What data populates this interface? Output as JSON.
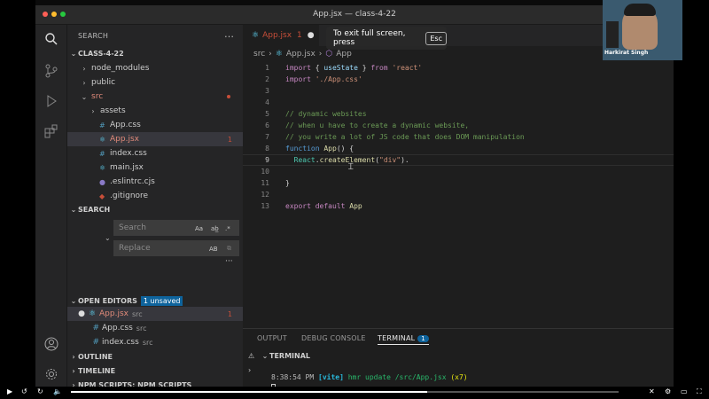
{
  "window": {
    "title": "App.jsx — class-4-22"
  },
  "sidebar": {
    "header": "SEARCH",
    "more_icon": "…",
    "project": "CLASS-4-22",
    "tree": [
      {
        "label": "node_modules",
        "kind": "folder",
        "open": false
      },
      {
        "label": "public",
        "kind": "folder",
        "open": false
      },
      {
        "label": "src",
        "kind": "folder",
        "open": true,
        "modified": true
      },
      {
        "label": "assets",
        "kind": "folder",
        "open": false
      },
      {
        "label": "App.css",
        "kind": "file"
      },
      {
        "label": "App.jsx",
        "kind": "file",
        "selected": true,
        "badge": "1"
      },
      {
        "label": "index.css",
        "kind": "file"
      },
      {
        "label": "main.jsx",
        "kind": "file"
      },
      {
        "label": ".eslintrc.cjs",
        "kind": "file"
      },
      {
        "label": ".gitignore",
        "kind": "file"
      }
    ],
    "search_section": "SEARCH",
    "search_placeholder": "Search",
    "replace_placeholder": "Replace",
    "search_opt_case": "Aa",
    "search_opt_regex": ".*",
    "replace_opt": "AB",
    "more_dots": "···",
    "open_editors": "OPEN EDITORS",
    "unsaved_badge": "1 unsaved",
    "open_files": [
      {
        "name": "App.jsx",
        "dir": "src",
        "badge": "1",
        "dirty": true
      },
      {
        "name": "App.css",
        "dir": "src"
      },
      {
        "name": "index.css",
        "dir": "src"
      }
    ],
    "outline": "OUTLINE",
    "timeline": "TIMELINE",
    "npm_scripts": "NPM SCRIPTS: NPM SCRIPTS"
  },
  "editor": {
    "tab_label": "App.jsx",
    "tab_badge": "1",
    "breadcrumb": [
      "src",
      "App.jsx",
      "App"
    ],
    "toast_text": "To exit full screen, press",
    "toast_key": "Esc",
    "lines": [
      {
        "n": "1",
        "html": "<span class='kw'>import</span> { <span class='var'>useState</span> } <span class='kw'>from</span> <span class='str'>'react'</span>"
      },
      {
        "n": "2",
        "html": "<span class='kw'>import</span> <span class='str'>'./App.css'</span>"
      },
      {
        "n": "3",
        "html": ""
      },
      {
        "n": "4",
        "html": ""
      },
      {
        "n": "5",
        "html": "<span class='cm'>// dynamic websites</span>"
      },
      {
        "n": "6",
        "html": "<span class='cm'>// when u have to create a dynamic website,</span>"
      },
      {
        "n": "7",
        "html": "<span class='cm'>// you write a lot of JS code that does DOM manipulation</span>"
      },
      {
        "n": "8",
        "html": "<span class='kw2'>function</span> <span class='fn'>App</span>() {"
      },
      {
        "n": "9",
        "html": "  <span class='cls'>React</span>.<span class='fn'>createElement</span>(<span class='str'>\"div\"</span>)."
      },
      {
        "n": "10",
        "html": ""
      },
      {
        "n": "11",
        "html": "}"
      },
      {
        "n": "12",
        "html": ""
      },
      {
        "n": "13",
        "html": "<span class='kw'>export</span> <span class='kw'>default</span> <span class='fn'>App</span>"
      }
    ]
  },
  "panel": {
    "tabs": [
      "OUTPUT",
      "DEBUG CONSOLE",
      "TERMINAL"
    ],
    "terminal_badge": "1",
    "section": "TERMINAL",
    "log_time": "8:38:54 PM",
    "log_tag": "[vite]",
    "log_msg": "hmr update /src/App.jsx",
    "log_count": "(x7)"
  },
  "webcam": {
    "name": "Harkirat Singh"
  },
  "player": {
    "progress": 0.65
  },
  "colors": {
    "accent": "#0e639c",
    "error": "#c74e39"
  }
}
